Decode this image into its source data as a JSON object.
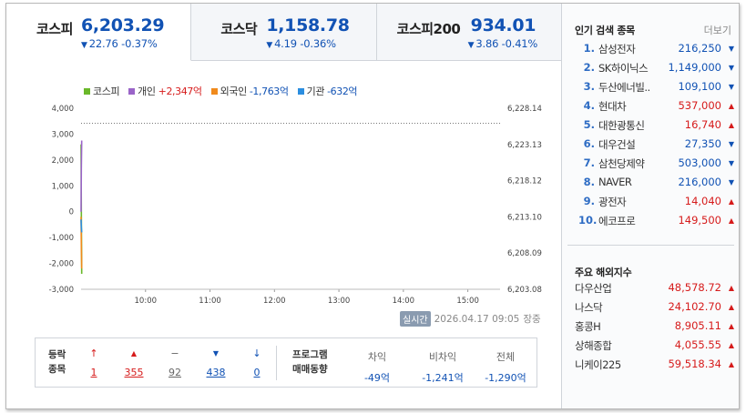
{
  "tabs": [
    {
      "name": "코스피",
      "value": "6,203.29",
      "change": "22.76",
      "rate": "-0.37%",
      "dir": "▼"
    },
    {
      "name": "코스닥",
      "value": "1,158.78",
      "change": "4.19",
      "rate": "-0.36%",
      "dir": "▼"
    },
    {
      "name": "코스피200",
      "value": "934.01",
      "change": "3.86",
      "rate": "-0.41%",
      "dir": "▼"
    }
  ],
  "legend": [
    {
      "label": "코스피",
      "value": "",
      "color": "#6ab82a"
    },
    {
      "label": "개인",
      "value": "+2,347억",
      "color": "#9a64c8"
    },
    {
      "label": "외국인",
      "value": "-1,763억",
      "color": "#f08a1c"
    },
    {
      "label": "기관",
      "value": "-632억",
      "color": "#2b8ee0"
    }
  ],
  "chart_data": {
    "type": "line",
    "x_ticks": [
      "10:00",
      "11:00",
      "12:00",
      "13:00",
      "14:00",
      "15:00"
    ],
    "y_left_ticks": [
      "4,000",
      "3,000",
      "2,000",
      "1,000",
      "0",
      "-1,000",
      "-2,000",
      "-3,000"
    ],
    "y_left_range": [
      -3000,
      4000
    ],
    "y_right_ticks": [
      "6,228.14",
      "6,223.13",
      "6,218.12",
      "6,213.10",
      "6,208.09",
      "6,203.08"
    ],
    "y_right_range": [
      6203.08,
      6228.14
    ],
    "series": [
      {
        "name": "코스피",
        "color": "#6ab82a",
        "points": [
          [
            0,
            2600
          ],
          [
            0.3,
            0
          ],
          [
            0.7,
            -2400
          ]
        ]
      },
      {
        "name": "개인",
        "color": "#9a64c8",
        "points": [
          [
            0,
            0
          ],
          [
            0.3,
            1700
          ],
          [
            0.7,
            2750
          ]
        ]
      },
      {
        "name": "외국인",
        "color": "#f08a1c",
        "points": [
          [
            0,
            -200
          ],
          [
            0.3,
            -1300
          ],
          [
            0.7,
            -2200
          ]
        ]
      },
      {
        "name": "기관",
        "color": "#2b8ee0",
        "points": [
          [
            0,
            -300
          ],
          [
            0.3,
            -600
          ],
          [
            0.7,
            -800
          ]
        ]
      }
    ],
    "reference_line": 3420
  },
  "stamp": {
    "badge": "실시간",
    "datetime": "2026.04.17 09:05",
    "status": "장중"
  },
  "breadth": {
    "label_line1": "등락",
    "label_line2": "종목",
    "items": [
      {
        "symbol": "↑",
        "count": "1",
        "color": "red"
      },
      {
        "symbol": "▲",
        "count": "355",
        "color": "red"
      },
      {
        "symbol": "−",
        "count": "92",
        "color": "gray"
      },
      {
        "symbol": "▼",
        "count": "438",
        "color": "blue"
      },
      {
        "symbol": "↓",
        "count": "0",
        "color": "blue"
      }
    ]
  },
  "program": {
    "label_line1": "프로그램",
    "label_line2": "매매동향",
    "items": [
      {
        "label": "차익",
        "value": "-49억"
      },
      {
        "label": "비차익",
        "value": "-1,241억"
      },
      {
        "label": "전체",
        "value": "-1,290억"
      }
    ]
  },
  "popular": {
    "title": "인기 검색 종목",
    "more": "더보기",
    "items": [
      {
        "rank": "1.",
        "name": "삼성전자",
        "price": "216,250",
        "dir": "▼",
        "color": "blue"
      },
      {
        "rank": "2.",
        "name": "SK하이닉스",
        "price": "1,149,000",
        "dir": "▼",
        "color": "blue"
      },
      {
        "rank": "3.",
        "name": "두산에너빌..",
        "price": "109,100",
        "dir": "▼",
        "color": "blue"
      },
      {
        "rank": "4.",
        "name": "현대차",
        "price": "537,000",
        "dir": "▲",
        "color": "red"
      },
      {
        "rank": "5.",
        "name": "대한광통신",
        "price": "16,740",
        "dir": "▲",
        "color": "red"
      },
      {
        "rank": "6.",
        "name": "대우건설",
        "price": "27,350",
        "dir": "▼",
        "color": "blue"
      },
      {
        "rank": "7.",
        "name": "삼천당제약",
        "price": "503,000",
        "dir": "▼",
        "color": "blue"
      },
      {
        "rank": "8.",
        "name": "NAVER",
        "price": "216,000",
        "dir": "▼",
        "color": "blue"
      },
      {
        "rank": "9.",
        "name": "광전자",
        "price": "14,040",
        "dir": "▲",
        "color": "red"
      },
      {
        "rank": "10.",
        "name": "에코프로",
        "price": "149,500",
        "dir": "▲",
        "color": "red"
      }
    ]
  },
  "world": {
    "title": "주요 해외지수",
    "items": [
      {
        "name": "다우산업",
        "price": "48,578.72",
        "dir": "▲"
      },
      {
        "name": "나스닥",
        "price": "24,102.70",
        "dir": "▲"
      },
      {
        "name": "홍콩H",
        "price": "8,905.11",
        "dir": "▲"
      },
      {
        "name": "상해종합",
        "price": "4,055.55",
        "dir": "▲"
      },
      {
        "name": "니케이225",
        "price": "59,518.34",
        "dir": "▲"
      }
    ]
  }
}
